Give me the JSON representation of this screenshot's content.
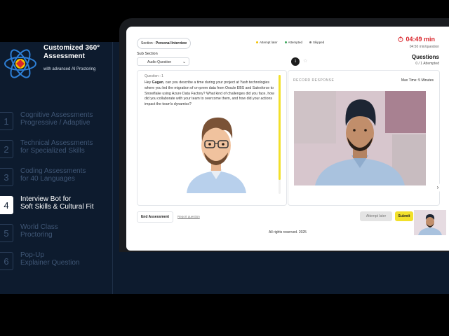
{
  "sidebar": {
    "brand_title": "Customized 360° Assessment",
    "brand_subtitle": "with advanced AI Proctoring",
    "items": [
      {
        "num": "1",
        "label": "Cognitive Assessments\nProgressive / Adaptive",
        "active": false
      },
      {
        "num": "2",
        "label": "Technical Assessments\nfor Specialized Skills",
        "active": false
      },
      {
        "num": "3",
        "label": "Coding Assessments\nfor 40 Languages",
        "active": false
      },
      {
        "num": "4",
        "label": "Interview Bot for\nSoft Skills & Cultural Fit",
        "active": true
      },
      {
        "num": "5",
        "label": "World Class\nProctoring",
        "active": false
      },
      {
        "num": "6",
        "label": "Pop-Up\nExplainer Question",
        "active": false
      }
    ]
  },
  "header": {
    "section_prefix": "Section : ",
    "section_value": "Personal Interview",
    "legend": [
      {
        "label": "Attempt later",
        "color": "#f2c200"
      },
      {
        "label": "Attempted",
        "color": "#3aa55a"
      },
      {
        "label": "Skipped",
        "color": "#7a7a7a"
      }
    ],
    "timer": "04:49 min",
    "timer_sub": "04:50 min/question",
    "subsection_label": "Sub Section",
    "subsection_value": "Audio Question",
    "active_question": "1",
    "questions_title": "Questions",
    "questions_sub": "0 / 1 Attempted"
  },
  "question": {
    "label": "Question : 1",
    "name": "Gagan",
    "text_before": "Hey ",
    "text_after": ", can you describe a time during your project at Yash technologies where you led the migration of on-prem data from Oracle EBS and Salesforce to Snowflake using Azure Data Factory? What kind of challenges did you face, how did you collaborate with your team to overcome them, and how did your actions impact the team's dynamics?"
  },
  "record": {
    "label": "Record Response",
    "max_time": "Max Time: 5 Minutes"
  },
  "footer": {
    "end_label": "End Assessment",
    "report_label": "Report question",
    "attempt_label": "Attempt later",
    "submit_label": "Submit",
    "copyright": "All rights reserved. 2025"
  },
  "colors": {
    "accent": "#f2e02a",
    "timer": "#d9262c",
    "sidebar_bg": "#0d1b2e"
  }
}
